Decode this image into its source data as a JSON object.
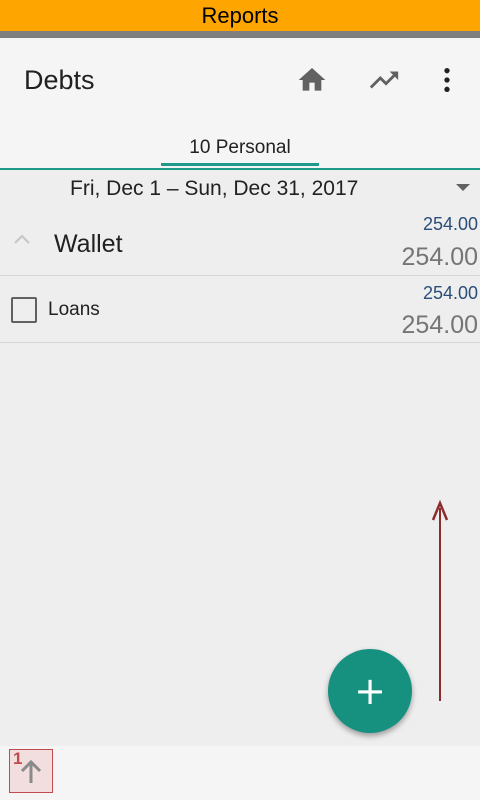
{
  "banner": {
    "title": "Reports",
    "color": "#ffa500"
  },
  "appbar": {
    "title": "Debts",
    "actions": [
      {
        "name": "home-icon"
      },
      {
        "name": "trending-up-icon"
      },
      {
        "name": "more-vert-icon"
      }
    ]
  },
  "tabs": [
    {
      "label": "10 Personal",
      "selected": true
    }
  ],
  "date_range": {
    "label": "Fri, Dec 1 – Sun, Dec 31, 2017"
  },
  "accounts": [
    {
      "label": "Wallet",
      "amount_top": "254.00",
      "amount_bottom": "254.00",
      "expanded": true
    },
    {
      "label": "Loans",
      "amount_top": "254.00",
      "amount_bottom": "254.00",
      "checked": false
    }
  ],
  "fab": {
    "label": "+",
    "color": "#16907f"
  },
  "bottom": {
    "sort_number": "1"
  },
  "colors": {
    "accent": "#1e9a8a",
    "amount_blue": "#2a4e78",
    "arrow": "#8b2d2d"
  }
}
